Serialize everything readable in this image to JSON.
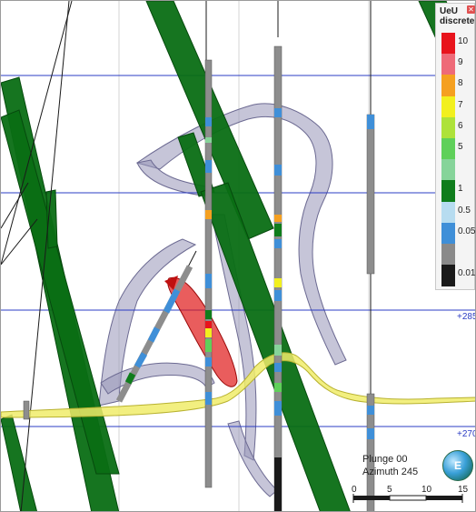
{
  "legend": {
    "title_line1": "UeU",
    "title_line2": "discrete",
    "close_icon": "close-icon",
    "items": [
      {
        "label": "10",
        "color": "#e8141c"
      },
      {
        "label": "9",
        "color": "#ee6a78"
      },
      {
        "label": "8",
        "color": "#f5a020"
      },
      {
        "label": "7",
        "color": "#f2f01e"
      },
      {
        "label": "6",
        "color": "#aee23a"
      },
      {
        "label": "5",
        "color": "#5fd05a"
      },
      {
        "label": "",
        "color": "#86d49a"
      },
      {
        "label": "1",
        "color": "#0f7d1c"
      },
      {
        "label": "0.5",
        "color": "#b7dcf0"
      },
      {
        "label": "0.05",
        "color": "#3f8fd8"
      },
      {
        "label": "",
        "color": "#8a8a8a"
      },
      {
        "label": "0.01",
        "color": "#1a1a1a"
      }
    ]
  },
  "elevation_labels": [
    "+285",
    "+270"
  ],
  "orientation": {
    "plunge": "Plunge 00",
    "azimuth": "Azimuth 245"
  },
  "compass": {
    "letter": "E",
    "icon": "compass-globe-icon"
  },
  "scale": {
    "ticks": [
      "0",
      "5",
      "10",
      "15"
    ]
  },
  "colors": {
    "plane": "#0a6e14",
    "surface": "#a9a7c4",
    "fault": "#f0ec6a",
    "gridline": "#2b3cc4",
    "hot_zone": "#e01818"
  }
}
